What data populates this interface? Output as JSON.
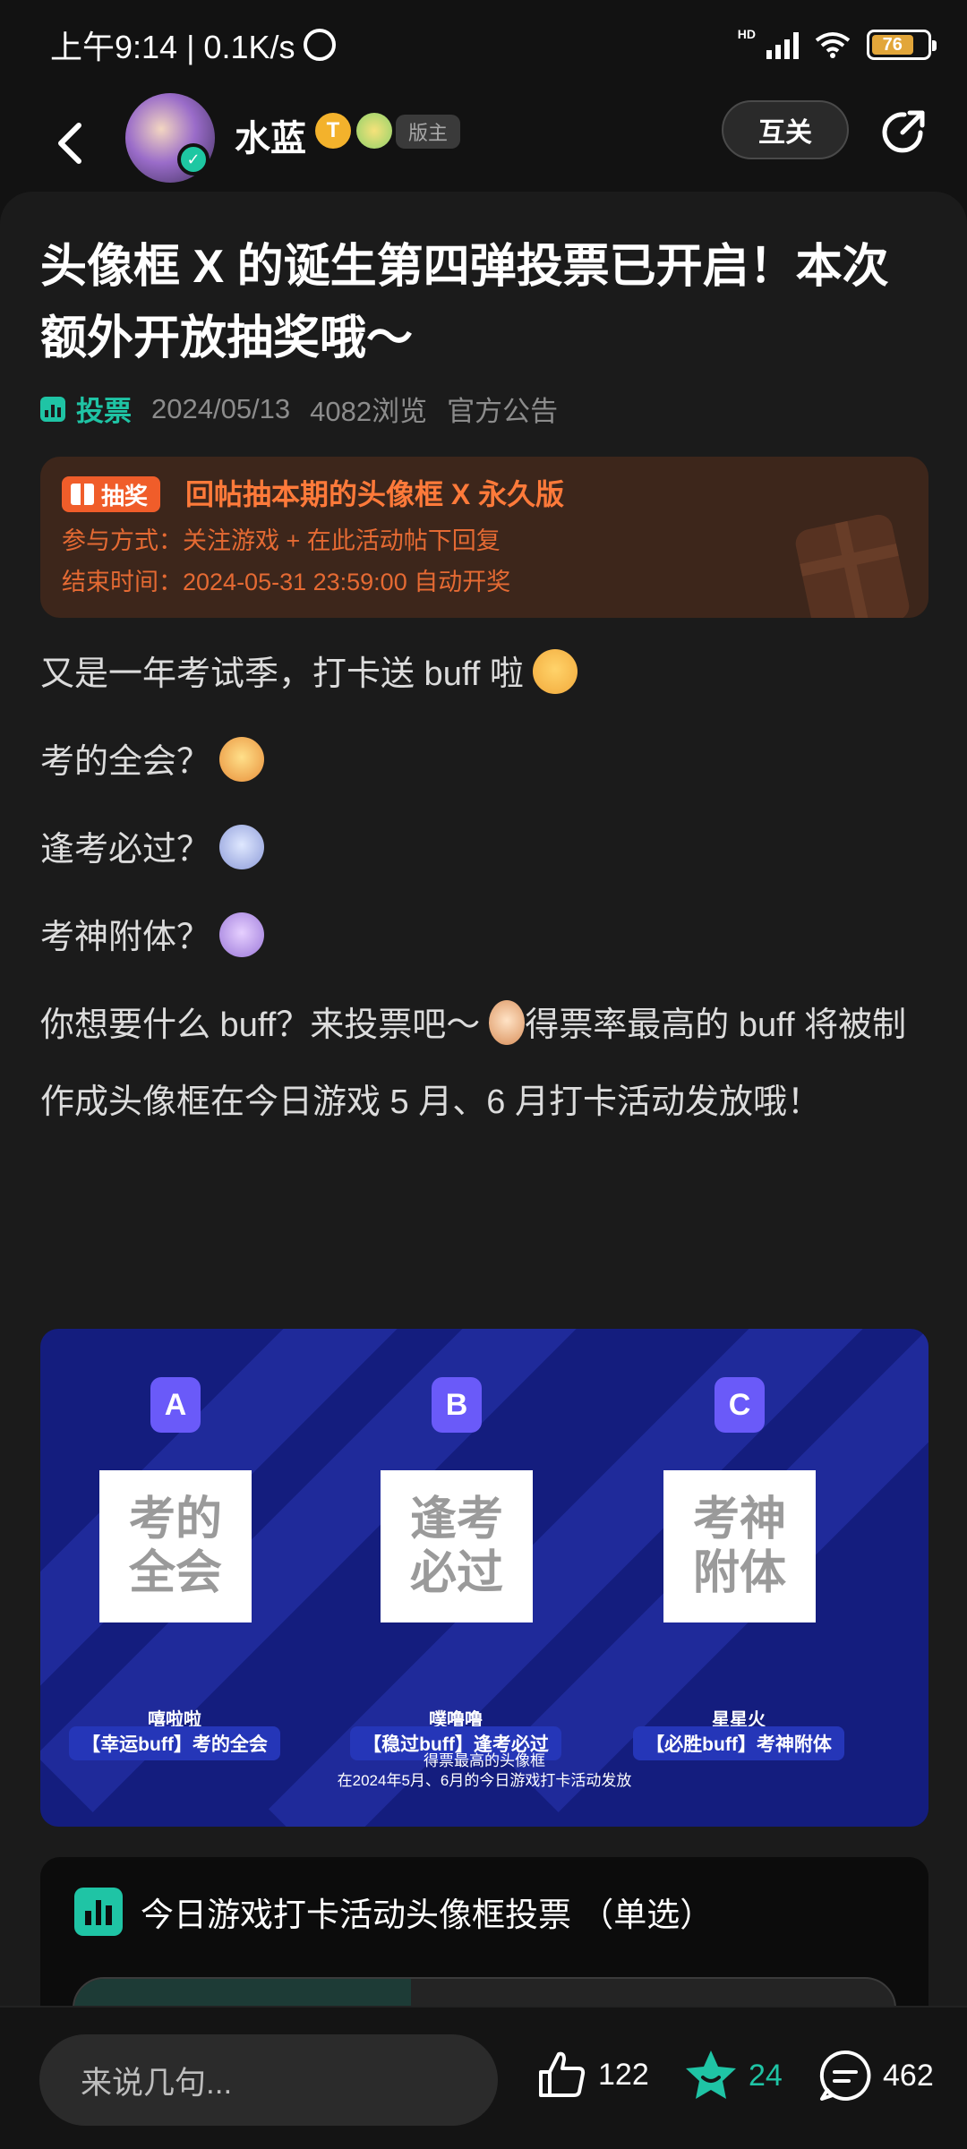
{
  "status_bar": {
    "time_speed": "上午9:14 | 0.1K/s",
    "network": "HD",
    "battery": "76"
  },
  "header": {
    "username": "水蓝",
    "level_badge": "T",
    "role": "版主",
    "follow_label": "互关"
  },
  "post": {
    "title": "头像框 X 的诞生第四弹投票已开启！本次额外开放抽奖哦～",
    "tag": "投票",
    "date": "2024/05/13",
    "views": "4082浏览",
    "category": "官方公告",
    "lottery": {
      "tag": "抽奖",
      "title": "回帖抽本期的头像框 X 永久版",
      "how": "参与方式：关注游戏 + 在此活动帖下回复",
      "end": "结束时间：2024-05-31 23:59:00 自动开奖"
    },
    "paragraphs": [
      "又是一年考试季，打卡送 buff 啦",
      "考的全会？",
      "逢考必过？",
      "考神附体？",
      "你想要什么 buff？来投票吧～",
      "得票率最高的 buff 将被制作成头像框在今日游戏 5 月、6 月打卡活动发放哦！"
    ],
    "image": {
      "options": [
        {
          "letter": "A",
          "line1": "考的",
          "line2": "全会",
          "name": "嘻啦啦",
          "desc": "【幸运buff】考的全会"
        },
        {
          "letter": "B",
          "line1": "逢考",
          "line2": "必过",
          "name": "噗噜噜",
          "desc": "【稳过buff】逢考必过"
        },
        {
          "letter": "C",
          "line1": "考神",
          "line2": "附体",
          "name": "星星火",
          "desc": "【必胜buff】考神附体"
        }
      ],
      "footer1": "得票最高的头像框",
      "footer2": "在2024年5月、6月的今日游戏打卡活动发放"
    },
    "vote": {
      "title": "今日游戏打卡活动头像框投票 （单选）",
      "first_option_fill": 0.41
    }
  },
  "bottom_bar": {
    "comment_placeholder": "来说几句...",
    "likes": "122",
    "stars": "24",
    "comments": "462"
  },
  "colors": {
    "accent": "#1fc4a5",
    "lottery_orange": "#ff7a3a",
    "image_bg": "#141d7e"
  }
}
